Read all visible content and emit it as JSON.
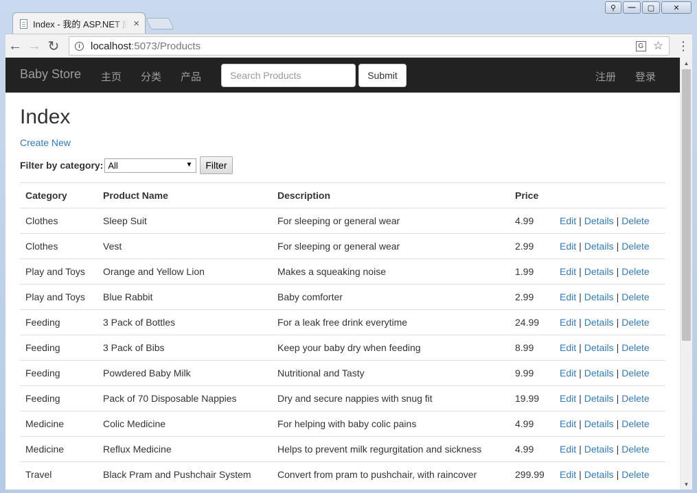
{
  "browser": {
    "tab_title": "Index - 我的 ASP.NET 应用程序",
    "tab_close": "×",
    "url_host": "localhost",
    "url_path": ":5073/Products",
    "back_icon": "←",
    "forward_icon": "→",
    "reload_icon": "↻",
    "menu_icon": "⋮",
    "star_icon": "☆"
  },
  "navbar": {
    "brand": "Baby Store",
    "links": [
      "主页",
      "分类",
      "产品"
    ],
    "search_placeholder": "Search Products",
    "submit_label": "Submit",
    "right_links": [
      "注册",
      "登录"
    ]
  },
  "page": {
    "title": "Index",
    "create_new": "Create New",
    "filter_label": "Filter by category:",
    "filter_value": "All",
    "filter_button": "Filter"
  },
  "table": {
    "headers": [
      "Category",
      "Product Name",
      "Description",
      "Price"
    ],
    "actions": [
      "Edit",
      "Details",
      "Delete"
    ],
    "separator": "|",
    "rows": [
      {
        "category": "Clothes",
        "name": "Sleep Suit",
        "description": "For sleeping or general wear",
        "price": "4.99"
      },
      {
        "category": "Clothes",
        "name": "Vest",
        "description": "For sleeping or general wear",
        "price": "2.99"
      },
      {
        "category": "Play and Toys",
        "name": "Orange and Yellow Lion",
        "description": "Makes a squeaking noise",
        "price": "1.99"
      },
      {
        "category": "Play and Toys",
        "name": "Blue Rabbit",
        "description": "Baby comforter",
        "price": "2.99"
      },
      {
        "category": "Feeding",
        "name": "3 Pack of Bottles",
        "description": "For a leak free drink everytime",
        "price": "24.99"
      },
      {
        "category": "Feeding",
        "name": "3 Pack of Bibs",
        "description": "Keep your baby dry when feeding",
        "price": "8.99"
      },
      {
        "category": "Feeding",
        "name": "Powdered Baby Milk",
        "description": "Nutritional and Tasty",
        "price": "9.99"
      },
      {
        "category": "Feeding",
        "name": "Pack of 70 Disposable Nappies",
        "description": "Dry and secure nappies with snug fit",
        "price": "19.99"
      },
      {
        "category": "Medicine",
        "name": "Colic Medicine",
        "description": "For helping with baby colic pains",
        "price": "4.99"
      },
      {
        "category": "Medicine",
        "name": "Reflux Medicine",
        "description": "Helps to prevent milk regurgitation and sickness",
        "price": "4.99"
      },
      {
        "category": "Travel",
        "name": "Black Pram and Pushchair System",
        "description": "Convert from pram to pushchair, with raincover",
        "price": "299.99"
      }
    ]
  },
  "colors": {
    "navbar_bg": "#222222",
    "link": "#337ab7",
    "nav_text": "#9d9d9d"
  }
}
